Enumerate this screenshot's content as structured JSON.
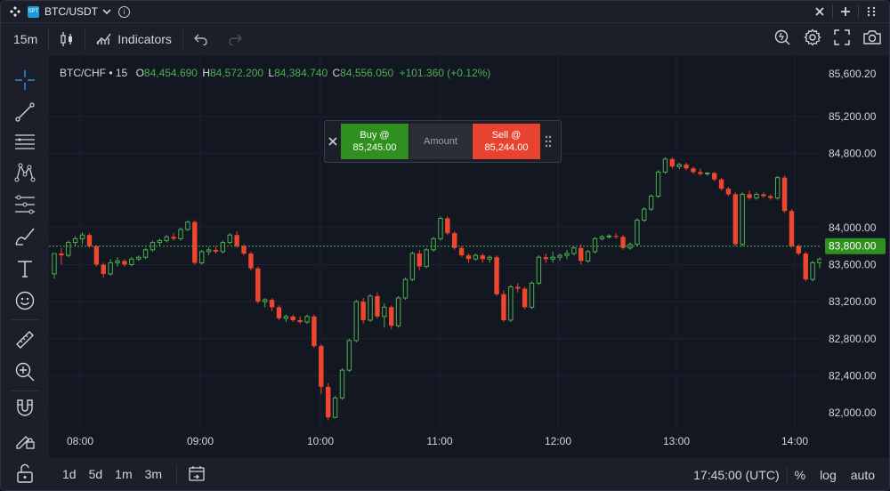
{
  "window": {
    "symbol": "BTC/USDT",
    "badge": "SPT",
    "info_glyph": "i"
  },
  "toolbar": {
    "interval": "15m",
    "indicators_label": "Indicators"
  },
  "legend": {
    "title": "BTC/CHF • 15",
    "o_label": "O",
    "o_value": "84,454.690",
    "h_label": "H",
    "h_value": "84,572.200",
    "l_label": "L",
    "l_value": "84,384.740",
    "c_label": "C",
    "c_value": "84,556.050",
    "change": "+101.360 (+0.12%)"
  },
  "trade": {
    "buy_label": "Buy @",
    "buy_price": "85,245.00",
    "amount_label": "Amount",
    "sell_label": "Sell @",
    "sell_price": "85,244.00"
  },
  "price_axis": {
    "ticks": [
      "85,600.20",
      "85,200.00",
      "84,800.00",
      "84,000.00",
      "83,600.00",
      "83,200.00",
      "82,800.00",
      "82,400.00",
      "82,000.00"
    ],
    "current_price": "83,800.00"
  },
  "time_axis": {
    "ticks": [
      "08:00",
      "09:00",
      "10:00",
      "11:00",
      "12:00",
      "13:00",
      "14:00"
    ]
  },
  "bottom": {
    "ranges": [
      "1d",
      "5d",
      "1m",
      "3m"
    ],
    "clock": "17:45:00 (UTC)",
    "percent": "%",
    "log": "log",
    "auto": "auto"
  },
  "colors": {
    "up": "#4caf50",
    "down": "#f0452e",
    "buy": "#2f8f1f",
    "sell": "#e8432e",
    "price_line": "#4caf50",
    "current_price_bg": "#2f8f1f"
  },
  "chart_data": {
    "type": "candlestick",
    "title": "BTC/CHF • 15",
    "x_ticks": [
      "08:00",
      "09:00",
      "10:00",
      "11:00",
      "12:00",
      "13:00",
      "14:00"
    ],
    "y_ticks": [
      85600.2,
      85200,
      84800,
      84000,
      83600,
      83200,
      82800,
      82400,
      82000
    ],
    "current_price": 83800,
    "candles": [
      [
        83500,
        83700,
        83450,
        83720
      ],
      [
        83720,
        83780,
        83600,
        83700
      ],
      [
        83700,
        83860,
        83680,
        83840
      ],
      [
        83840,
        83910,
        83800,
        83880
      ],
      [
        83880,
        83950,
        83820,
        83920
      ],
      [
        83920,
        83940,
        83780,
        83800
      ],
      [
        83800,
        83810,
        83580,
        83600
      ],
      [
        83600,
        83620,
        83460,
        83500
      ],
      [
        83500,
        83660,
        83480,
        83620
      ],
      [
        83620,
        83680,
        83580,
        83640
      ],
      [
        83640,
        83660,
        83580,
        83600
      ],
      [
        83600,
        83680,
        83580,
        83660
      ],
      [
        83660,
        83700,
        83640,
        83680
      ],
      [
        83680,
        83780,
        83660,
        83760
      ],
      [
        83760,
        83860,
        83740,
        83840
      ],
      [
        83840,
        83880,
        83800,
        83860
      ],
      [
        83860,
        83920,
        83840,
        83900
      ],
      [
        83900,
        83940,
        83860,
        83880
      ],
      [
        83880,
        84000,
        83860,
        83980
      ],
      [
        83980,
        84080,
        83960,
        84060
      ],
      [
        84060,
        84080,
        83600,
        83620
      ],
      [
        83620,
        83760,
        83600,
        83740
      ],
      [
        83740,
        83790,
        83700,
        83760
      ],
      [
        83760,
        83800,
        83720,
        83740
      ],
      [
        83740,
        83860,
        83720,
        83840
      ],
      [
        83840,
        83940,
        83820,
        83920
      ],
      [
        83920,
        83960,
        83780,
        83800
      ],
      [
        83800,
        83820,
        83700,
        83720
      ],
      [
        83720,
        83740,
        83540,
        83560
      ],
      [
        83560,
        83580,
        83180,
        83200
      ],
      [
        83200,
        83240,
        83140,
        83220
      ],
      [
        83220,
        83240,
        83100,
        83140
      ],
      [
        83140,
        83160,
        83000,
        83020
      ],
      [
        83020,
        83060,
        82980,
        83040
      ],
      [
        83040,
        83060,
        82980,
        83000
      ],
      [
        83000,
        83040,
        82960,
        82980
      ],
      [
        82980,
        83060,
        82960,
        83040
      ],
      [
        83040,
        83060,
        82700,
        82720
      ],
      [
        82720,
        82740,
        82200,
        82280
      ],
      [
        82280,
        82320,
        81920,
        81950
      ],
      [
        81950,
        82180,
        81940,
        82160
      ],
      [
        82160,
        82480,
        82140,
        82460
      ],
      [
        82460,
        82800,
        82440,
        82780
      ],
      [
        82780,
        83220,
        82760,
        83200
      ],
      [
        83200,
        83240,
        82960,
        83000
      ],
      [
        83000,
        83280,
        82980,
        83260
      ],
      [
        83260,
        83300,
        83020,
        83040
      ],
      [
        83040,
        83180,
        82920,
        83140
      ],
      [
        83140,
        83160,
        82900,
        82940
      ],
      [
        82940,
        83260,
        82920,
        83240
      ],
      [
        83240,
        83460,
        83220,
        83440
      ],
      [
        83440,
        83740,
        83420,
        83720
      ],
      [
        83720,
        83760,
        83540,
        83580
      ],
      [
        83580,
        83780,
        83560,
        83760
      ],
      [
        83760,
        83900,
        83740,
        83880
      ],
      [
        83880,
        84120,
        83860,
        84100
      ],
      [
        84100,
        84120,
        83920,
        83940
      ],
      [
        83940,
        83960,
        83760,
        83780
      ],
      [
        83780,
        83800,
        83680,
        83700
      ],
      [
        83700,
        83720,
        83620,
        83660
      ],
      [
        83660,
        83720,
        83640,
        83700
      ],
      [
        83700,
        83720,
        83620,
        83660
      ],
      [
        83660,
        83700,
        83620,
        83680
      ],
      [
        83680,
        83700,
        83260,
        83280
      ],
      [
        83280,
        83320,
        82980,
        83000
      ],
      [
        83000,
        83380,
        82980,
        83360
      ],
      [
        83360,
        83400,
        83300,
        83340
      ],
      [
        83340,
        83360,
        83120,
        83140
      ],
      [
        83140,
        83420,
        83120,
        83400
      ],
      [
        83400,
        83700,
        83380,
        83680
      ],
      [
        83680,
        83720,
        83620,
        83660
      ],
      [
        83660,
        83740,
        83620,
        83680
      ],
      [
        83680,
        83720,
        83640,
        83700
      ],
      [
        83700,
        83760,
        83660,
        83720
      ],
      [
        83720,
        83800,
        83700,
        83780
      ],
      [
        83780,
        83820,
        83600,
        83640
      ],
      [
        83640,
        83760,
        83620,
        83740
      ],
      [
        83740,
        83900,
        83720,
        83880
      ],
      [
        83880,
        83920,
        83860,
        83900
      ],
      [
        83900,
        83930,
        83880,
        83910
      ],
      [
        83910,
        83940,
        83880,
        83900
      ],
      [
        83900,
        83920,
        83760,
        83780
      ],
      [
        83780,
        83840,
        83760,
        83820
      ],
      [
        83820,
        84100,
        83800,
        84080
      ],
      [
        84080,
        84220,
        84060,
        84200
      ],
      [
        84200,
        84360,
        84180,
        84340
      ],
      [
        84340,
        84620,
        84320,
        84600
      ],
      [
        84600,
        84760,
        84580,
        84740
      ],
      [
        84740,
        84760,
        84640,
        84660
      ],
      [
        84660,
        84700,
        84630,
        84680
      ],
      [
        84680,
        84700,
        84620,
        84640
      ],
      [
        84640,
        84660,
        84580,
        84600
      ],
      [
        84600,
        84640,
        84560,
        84580
      ],
      [
        84580,
        84600,
        84560,
        84590
      ],
      [
        84590,
        84600,
        84500,
        84520
      ],
      [
        84520,
        84540,
        84400,
        84420
      ],
      [
        84420,
        84440,
        84340,
        84360
      ],
      [
        84360,
        84380,
        83800,
        83820
      ],
      [
        83820,
        84380,
        83800,
        84360
      ],
      [
        84360,
        84400,
        84300,
        84320
      ],
      [
        84320,
        84380,
        84300,
        84360
      ],
      [
        84360,
        84380,
        84320,
        84340
      ],
      [
        84340,
        84360,
        84300,
        84320
      ],
      [
        84320,
        84560,
        84300,
        84540
      ],
      [
        84540,
        84560,
        84160,
        84180
      ],
      [
        84180,
        84200,
        83780,
        83800
      ],
      [
        83800,
        83820,
        83700,
        83720
      ],
      [
        83720,
        83740,
        83420,
        83440
      ],
      [
        83440,
        83640,
        83420,
        83620
      ],
      [
        83620,
        83680,
        83560,
        83660
      ]
    ]
  }
}
